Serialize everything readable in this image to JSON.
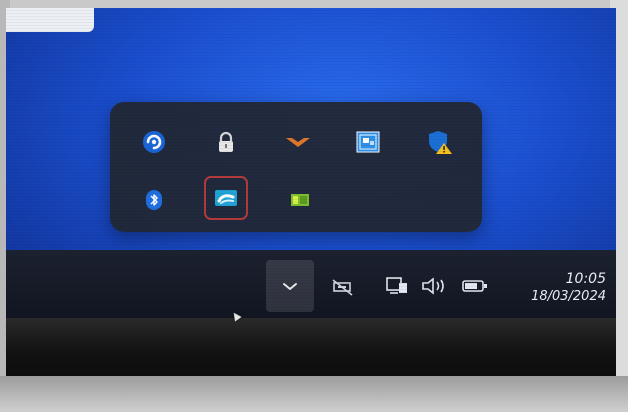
{
  "taskbar": {
    "clock": {
      "time": "10:05",
      "date": "18/03/2024"
    },
    "overflow_chevron_icon": "chevron-up-icon",
    "system_icons": [
      "network-disconnected-icon",
      "ethernet-icon",
      "volume-icon",
      "battery-icon"
    ]
  },
  "tray_flyout": {
    "row1": [
      "cloud-sync-icon",
      "lock-icon",
      "wings-logo-icon",
      "display-settings-icon",
      "security-warning-shield-icon"
    ],
    "row2": [
      "bluetooth-icon",
      "remote-desktop-icon",
      "graphics-card-icon"
    ],
    "selected_item": "remote-desktop-icon"
  },
  "colors": {
    "desktop_blue": "#1b4fd0",
    "taskbar": "#161b27",
    "flyout": "#22262f",
    "selection_border": "#b23a3a"
  }
}
